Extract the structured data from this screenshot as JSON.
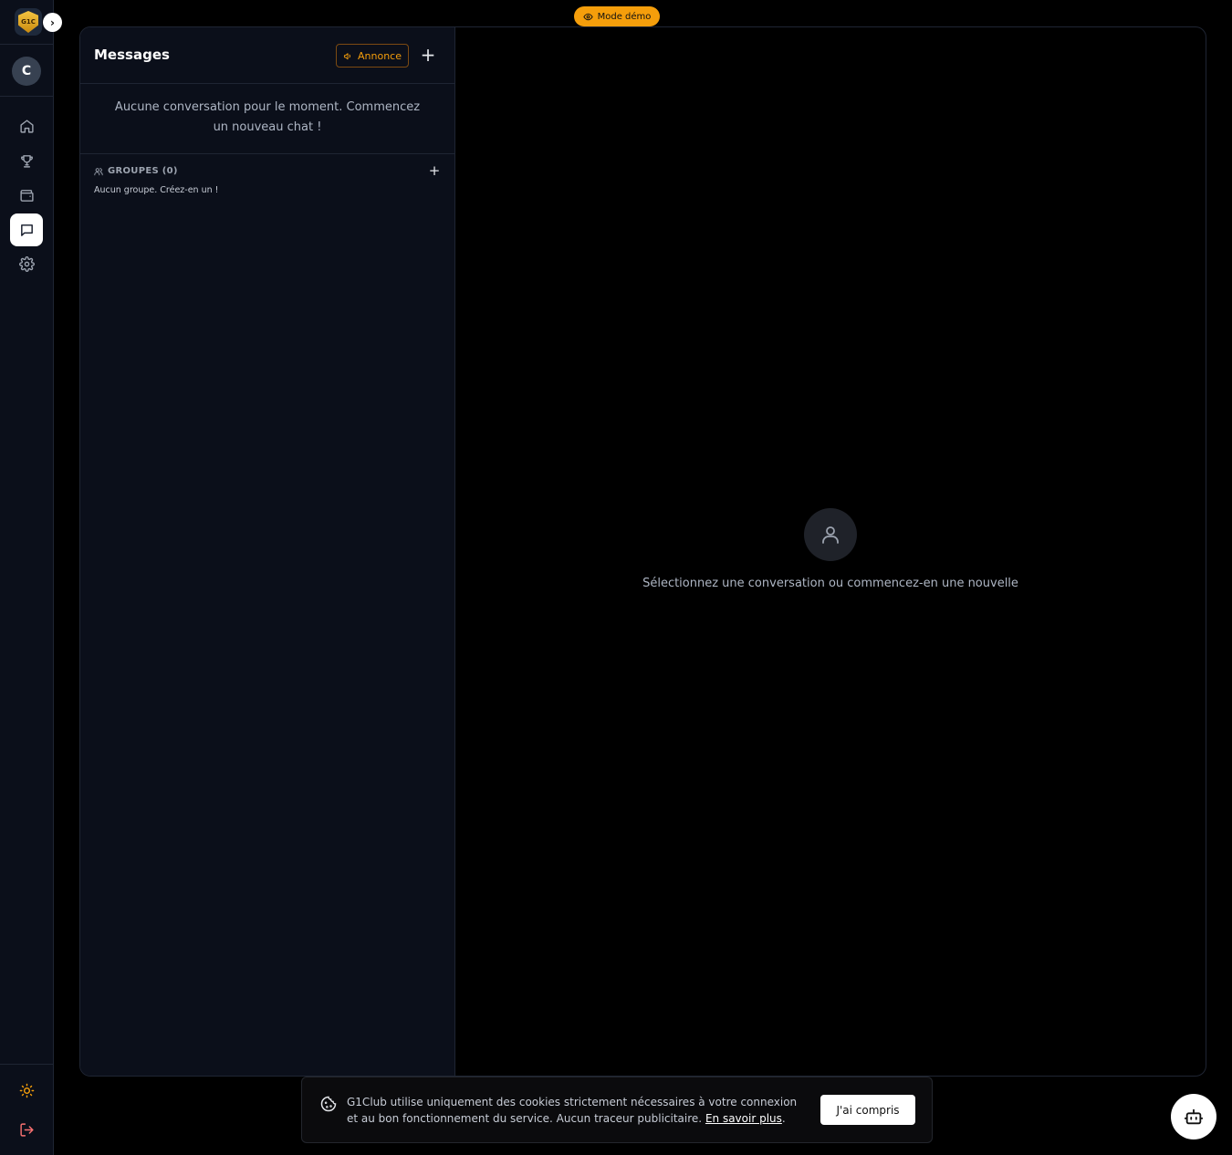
{
  "app": {
    "logo_text": "G1C",
    "avatar_initial": "C",
    "demo_label": "Mode démo"
  },
  "sidebar": {
    "items": [
      {
        "name": "home",
        "icon": "home-icon"
      },
      {
        "name": "trophy",
        "icon": "trophy-icon"
      },
      {
        "name": "wallet",
        "icon": "wallet-icon"
      },
      {
        "name": "messages",
        "icon": "chat-icon",
        "active": true
      },
      {
        "name": "settings",
        "icon": "gear-icon"
      }
    ],
    "bottom": [
      {
        "name": "theme",
        "icon": "sun-icon"
      },
      {
        "name": "logout",
        "icon": "logout-icon"
      }
    ]
  },
  "messages": {
    "title": "Messages",
    "announce_label": "Annonce",
    "empty_text": "Aucune conversation pour le moment. Commencez un nouveau chat !",
    "groups_title": "GROUPES (0)",
    "groups_empty": "Aucun groupe. Créez-en un !"
  },
  "chat": {
    "empty_text": "Sélectionnez une conversation ou commencez-en une nouvelle"
  },
  "cookie": {
    "text": "G1Club utilise uniquement des cookies strictement nécessaires à votre connexion et au bon fonctionnement du service. Aucun traceur publicitaire.",
    "link": "En savoir plus",
    "button": "J'ai compris"
  },
  "colors": {
    "accent": "#f59e0b",
    "panel_bg": "#0b0f1a",
    "background": "#000000",
    "logout": "#f87171"
  }
}
